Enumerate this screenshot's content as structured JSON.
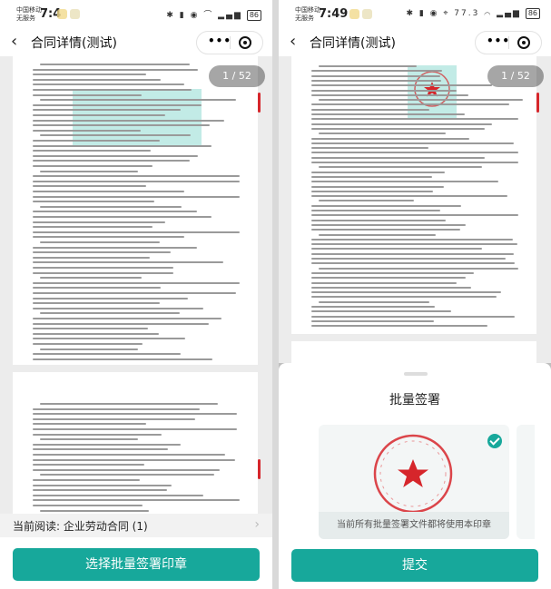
{
  "colors": {
    "accent": "#17a89b",
    "seal_red": "#d6262b"
  },
  "status_bar": {
    "left": {
      "carrier_top": "中国移动",
      "carrier_bottom": "无服务",
      "time": "7:4",
      "battery": "86"
    },
    "right": {
      "carrier_top": "中国移动",
      "carrier_bottom": "无服务",
      "time": "7:49",
      "speed": "77.3",
      "battery": "86"
    }
  },
  "nav": {
    "title": "合同详情(测试)",
    "back_icon": "back-icon",
    "more_icon": "more-icon",
    "target_icon": "target-icon"
  },
  "left": {
    "page_counter": "1 / 52",
    "current_reading": "当前阅读:  企业劳动合同 (1)",
    "button": "选择批量签署印章"
  },
  "right": {
    "page_counter": "1 / 52",
    "sheet": {
      "title": "批量签署",
      "seal_caption": "当前所有批量签署文件都将使用本印章",
      "submit": "提交"
    }
  }
}
